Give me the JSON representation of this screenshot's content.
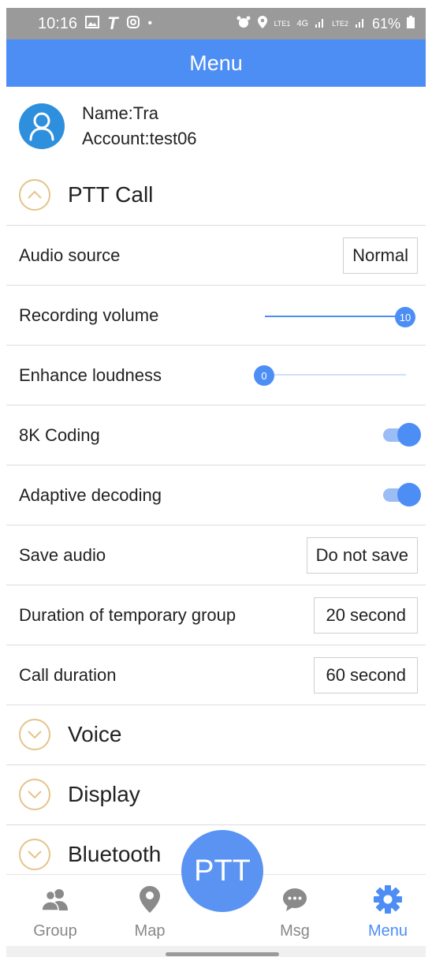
{
  "status_bar": {
    "time": "10:16",
    "left_icons": [
      "gallery-icon",
      "t-icon",
      "instagram-icon",
      "dot-icon"
    ],
    "right_icons": [
      "alarm-icon",
      "location-icon",
      "volte-icon",
      "4g-icon",
      "signal-icon",
      "signal-icon"
    ],
    "lte1": "LTE1",
    "lte2": "LTE2",
    "network": "4G",
    "battery": "61%"
  },
  "header": {
    "title": "Menu"
  },
  "profile": {
    "name": "Name:Tra",
    "account": "Account:test06"
  },
  "sections": {
    "ptt_call": "PTT Call",
    "voice": "Voice",
    "display": "Display",
    "bluetooth": "Bluetooth"
  },
  "settings": {
    "audio_source": {
      "label": "Audio source",
      "value": "Normal"
    },
    "recording_volume": {
      "label": "Recording volume",
      "value": "10",
      "level": 1.0
    },
    "enhance_loudness": {
      "label": "Enhance loudness",
      "value": "0",
      "level": 0.0
    },
    "coding_8k": {
      "label": "8K Coding",
      "on": true
    },
    "adaptive_decoding": {
      "label": "Adaptive decoding",
      "on": true
    },
    "save_audio": {
      "label": "Save audio",
      "value": "Do not save"
    },
    "temp_group_duration": {
      "label": "Duration of temporary group",
      "value": "20 second"
    },
    "call_duration": {
      "label": "Call duration",
      "value": "60 second"
    }
  },
  "ptt_button": "PTT",
  "bottom_nav": {
    "group": "Group",
    "map": "Map",
    "msg": "Msg",
    "menu": "Menu",
    "active": "Menu"
  },
  "colors": {
    "accent": "#4d8ef5",
    "chevron": "#e4c48a",
    "avatar": "#2e8fdd",
    "status_bar": "#9a9a9a"
  }
}
